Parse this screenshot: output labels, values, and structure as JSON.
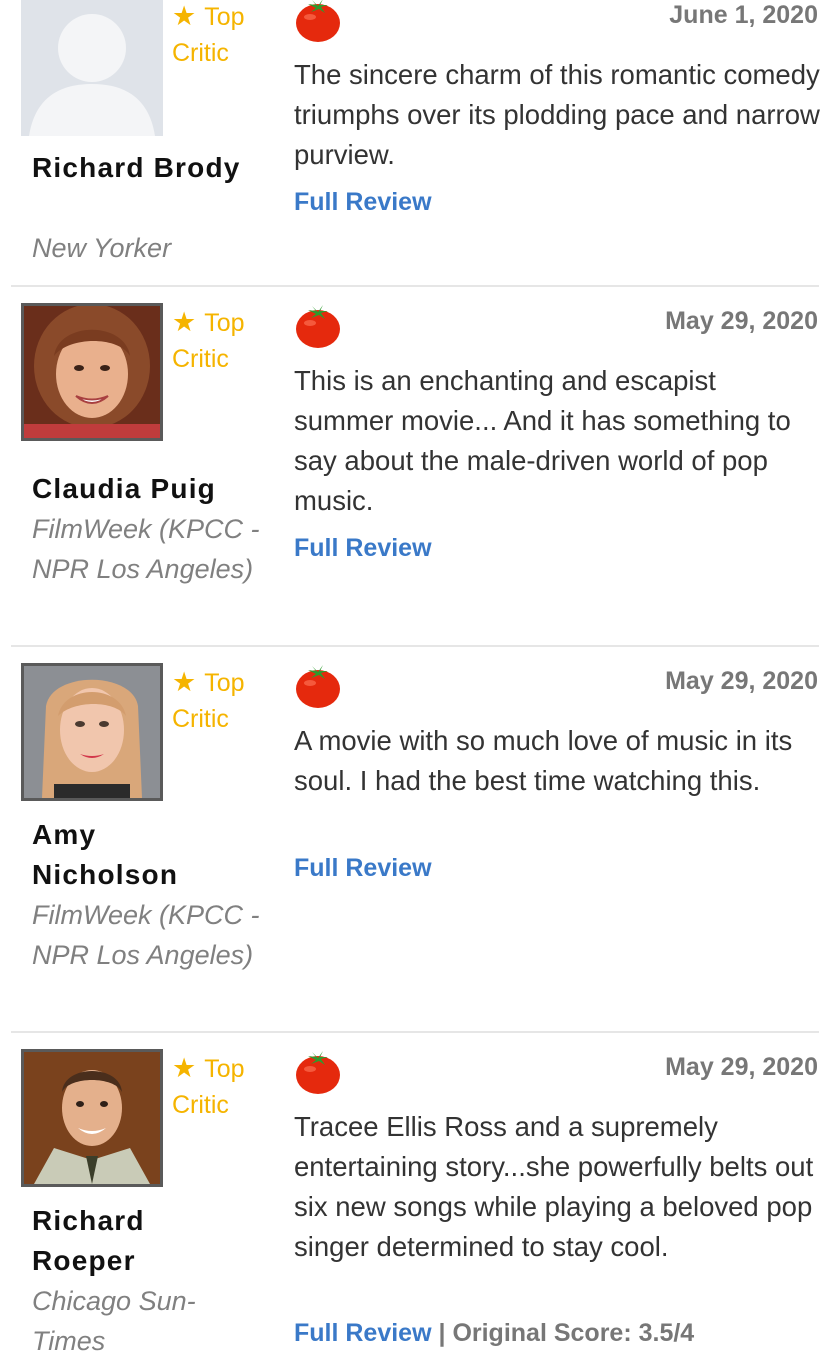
{
  "colors": {
    "top_critic": "#f5b400",
    "link": "#3a79c8",
    "tomato": "#e5290d",
    "stem": "#2e9b2e"
  },
  "badge": {
    "star_icon": "star-icon",
    "star": "★",
    "label": "Top Critic"
  },
  "reviews": [
    {
      "critic": "Richard Brody",
      "publication": "New Yorker",
      "date": "June 1, 2020",
      "rating_icon": "fresh-tomato-icon",
      "quote": "The sincere charm of this romantic comedy triumphs over its plodding pace and narrow purview.",
      "link": "Full Review"
    },
    {
      "critic": "Claudia Puig",
      "publication": "FilmWeek (KPCC - NPR Los Angeles)",
      "date": "May 29, 2020",
      "rating_icon": "fresh-tomato-icon",
      "quote": "This is an enchanting and escapist summer movie... And it has something to say about the male-driven world of pop music.",
      "link": "Full Review"
    },
    {
      "critic": "Amy Nicholson",
      "publication": "FilmWeek (KPCC - NPR Los Angeles)",
      "date": "May 29, 2020",
      "rating_icon": "fresh-tomato-icon",
      "quote": "A movie with so much love of music in its soul. I had the best time watching this.",
      "link": "Full Review"
    },
    {
      "critic": "Richard Roeper",
      "publication": "Chicago Sun-Times",
      "date": "May 29, 2020",
      "rating_icon": "fresh-tomato-icon",
      "quote": "Tracee Ellis Ross and a supremely entertaining story...she powerfully belts out six new songs while playing a beloved pop singer determined to stay cool.",
      "link": "Full Review",
      "score": "| Original Score: 3.5/4"
    }
  ]
}
